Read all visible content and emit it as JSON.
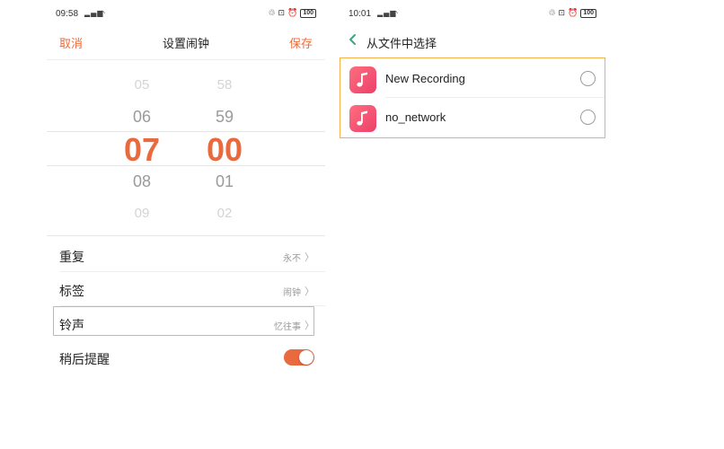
{
  "left_screen": {
    "status": {
      "time": "09:58",
      "battery": "100"
    },
    "header": {
      "cancel_label": "取消",
      "title": "设置闹钟",
      "save_label": "保存"
    },
    "picker": {
      "hours": {
        "above_far": "05",
        "above": "06",
        "selected": "07",
        "below": "08",
        "below_far": "09"
      },
      "minutes": {
        "above_far": "58",
        "above": "59",
        "selected": "00",
        "below": "01",
        "below_far": "02"
      }
    },
    "settings": [
      {
        "label": "重复",
        "value": "永不"
      },
      {
        "label": "标签",
        "value": "闹钟"
      },
      {
        "label": "铃声",
        "value": "忆往事"
      },
      {
        "label": "稍后提醒",
        "toggle_on": true
      }
    ]
  },
  "right_screen": {
    "status": {
      "time": "10:01",
      "battery": "100"
    },
    "header": {
      "title": "从文件中选择"
    },
    "files": [
      {
        "name": "New Recording",
        "selected": false
      },
      {
        "name": "no_network",
        "selected": false
      }
    ]
  },
  "colors": {
    "accent": "#e86a3e",
    "highlight": "#f5b04a",
    "back_arrow": "#3aa57f",
    "music_icon": "#ec3f6a"
  }
}
